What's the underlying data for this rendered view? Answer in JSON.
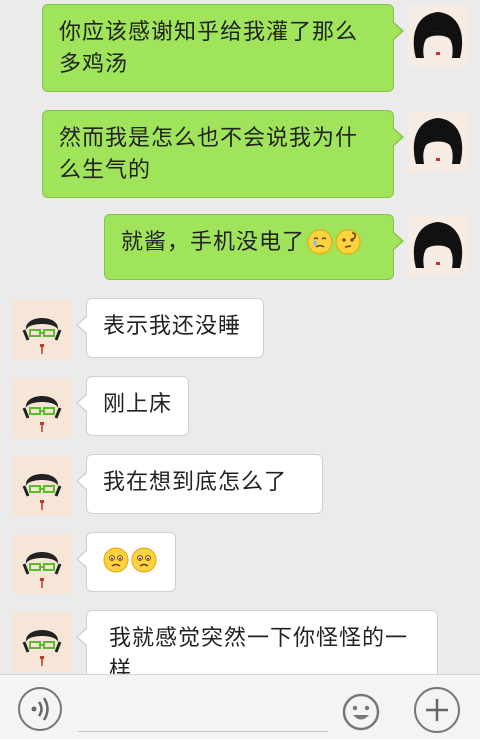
{
  "messages": [
    {
      "side": "me",
      "text": "你应该感谢知乎给我灌了那么多鸡汤"
    },
    {
      "side": "me",
      "text": "然而我是怎么也不会说我为什么生气的"
    },
    {
      "side": "me",
      "text": "就酱，手机没电了",
      "emojis": [
        "crying-face-icon",
        "thinking-face-icon"
      ]
    },
    {
      "side": "friend",
      "text": "表示我还没睡"
    },
    {
      "side": "friend",
      "text": "刚上床"
    },
    {
      "side": "friend",
      "text": "我在想到底怎么了"
    },
    {
      "side": "friend",
      "text": "",
      "emojis": [
        "worried-face-icon",
        "worried-face-icon"
      ]
    },
    {
      "side": "friend",
      "text": "我就感觉突然一下你怪怪的一样"
    }
  ],
  "icons": {
    "voice": "voice-input-icon",
    "emoji": "smile-icon",
    "more": "plus-icon"
  },
  "colors": {
    "my_bubble": "#9fe45a",
    "friend_bubble": "#ffffff",
    "background": "#ebebeb"
  }
}
